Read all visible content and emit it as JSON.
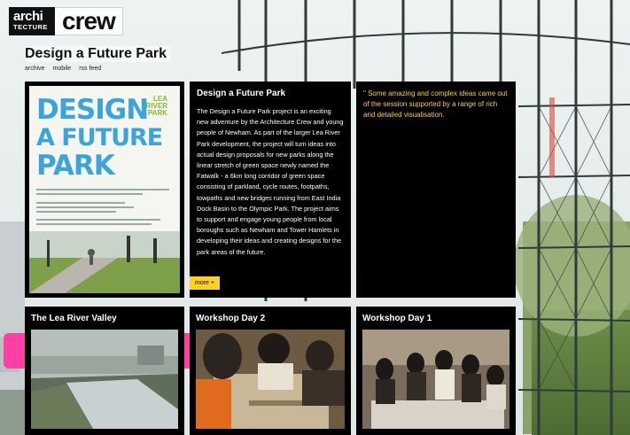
{
  "header": {
    "logo_archi": "archi",
    "logo_tecture": "TECTURE",
    "logo_crew": "crew",
    "page_title": "Design a Future Park",
    "subnav": [
      "archive",
      "mobile",
      "rss feed"
    ]
  },
  "poster": {
    "line1": "DESIGN",
    "line2": "A FUTURE",
    "line3": "PARK",
    "lea_line1": "LEA",
    "lea_line2": "RIVER",
    "lea_line3": "PARK"
  },
  "description": {
    "title": "Design a Future Park",
    "body": "The Design a Future Park project is an exciting new adventure by the Architecture Crew and young people of Newham. As part of the larger Lea River Park development, the project will turn ideas into actual design proposals for new parks along the linear stretch of green space newly named the Fatwalk - a 6km long corridor of green space consisting of parkland, cycle routes, footpaths, towpaths and new bridges running from East India Dock Basin to the Olympic Park. The project aims to support and engage young people from local boroughs such as Newham and Tower Hamlets in developing their ideas and creating designs for the park areas of the future.",
    "more_label": "more +"
  },
  "quote": {
    "text": "\" Some amazing and complex ideas came out of the session supported by a range of rich and detailed visualisation."
  },
  "cards": [
    {
      "title": "The Lea River Valley"
    },
    {
      "title": "Workshop Day 2"
    },
    {
      "title": "Workshop Day 1"
    }
  ],
  "colors": {
    "accent_yellow": "#ffd21f",
    "poster_blue": "#3ba4d8",
    "poster_green": "#88b92e",
    "pink": "#ff3fa6"
  }
}
